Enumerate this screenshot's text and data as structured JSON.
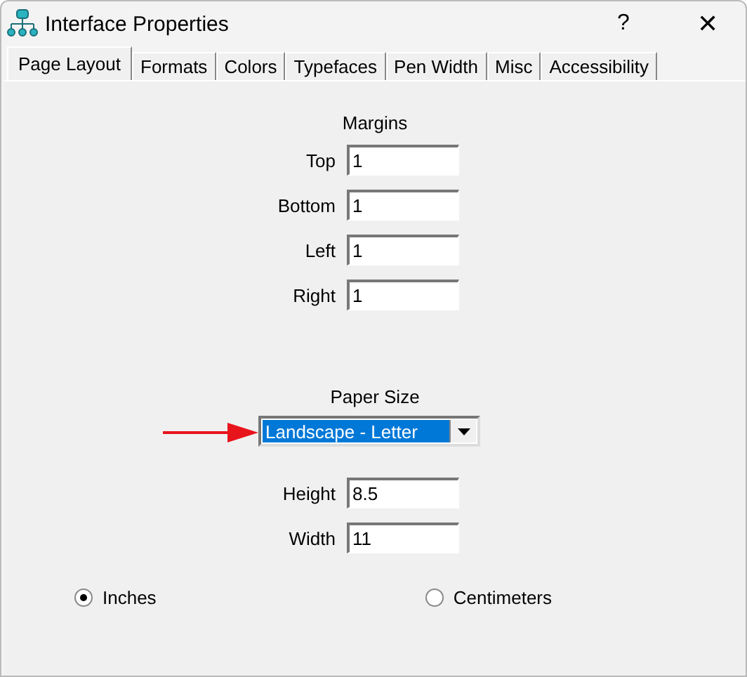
{
  "window": {
    "title": "Interface Properties",
    "help": "?",
    "close": "✕"
  },
  "tabs": [
    {
      "label": "Page Layout",
      "selected": true
    },
    {
      "label": "Formats",
      "selected": false
    },
    {
      "label": "Colors",
      "selected": false
    },
    {
      "label": "Typefaces",
      "selected": false
    },
    {
      "label": "Pen Width",
      "selected": false
    },
    {
      "label": "Misc",
      "selected": false
    },
    {
      "label": "Accessibility",
      "selected": false
    }
  ],
  "margins": {
    "heading": "Margins",
    "fields": [
      {
        "label": "Top",
        "value": "1"
      },
      {
        "label": "Bottom",
        "value": "1"
      },
      {
        "label": "Left",
        "value": "1"
      },
      {
        "label": "Right",
        "value": "1"
      }
    ]
  },
  "paper_size": {
    "heading": "Paper Size",
    "value": "Landscape - Letter",
    "highlighted": true,
    "pointer_arrow": true,
    "fields": [
      {
        "label": "Height",
        "value": "8.5"
      },
      {
        "label": "Width",
        "value": "11"
      }
    ]
  },
  "units": [
    {
      "label": "Inches",
      "selected": true
    },
    {
      "label": "Centimeters",
      "selected": false
    }
  ]
}
